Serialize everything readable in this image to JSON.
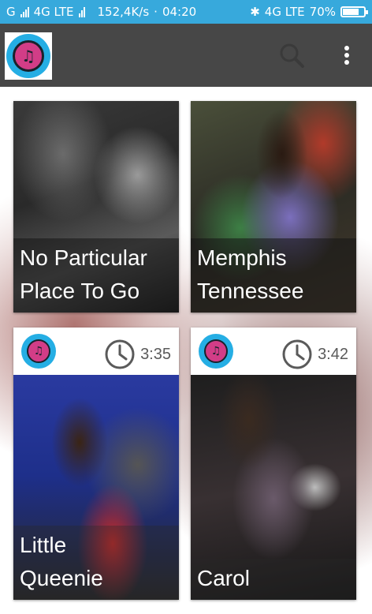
{
  "status_bar": {
    "carrier_left": "G",
    "network_left": "4G LTE",
    "speed": "152,4K/s",
    "time": "04:20",
    "network_right": "4G LTE",
    "battery": "70%"
  },
  "app_bar": {
    "logo_icon": "headphones-logo-icon",
    "search_icon": "search-icon",
    "menu_icon": "more-vert-icon"
  },
  "cards": [
    {
      "title_line1": "No Particular",
      "title_line2": "Place To Go",
      "duration": ""
    },
    {
      "title_line1": "Memphis",
      "title_line2": "Tennessee",
      "duration": ""
    },
    {
      "title_line1": "Little",
      "title_line2": "Queenie",
      "duration": "3:35"
    },
    {
      "title_line1": "",
      "title_line2": "Carol",
      "duration": "3:42"
    }
  ],
  "colors": {
    "status_bar": "#37a9dc",
    "app_bar": "#474747",
    "logo_ring": "#25aee4",
    "logo_center": "#d23d87"
  }
}
